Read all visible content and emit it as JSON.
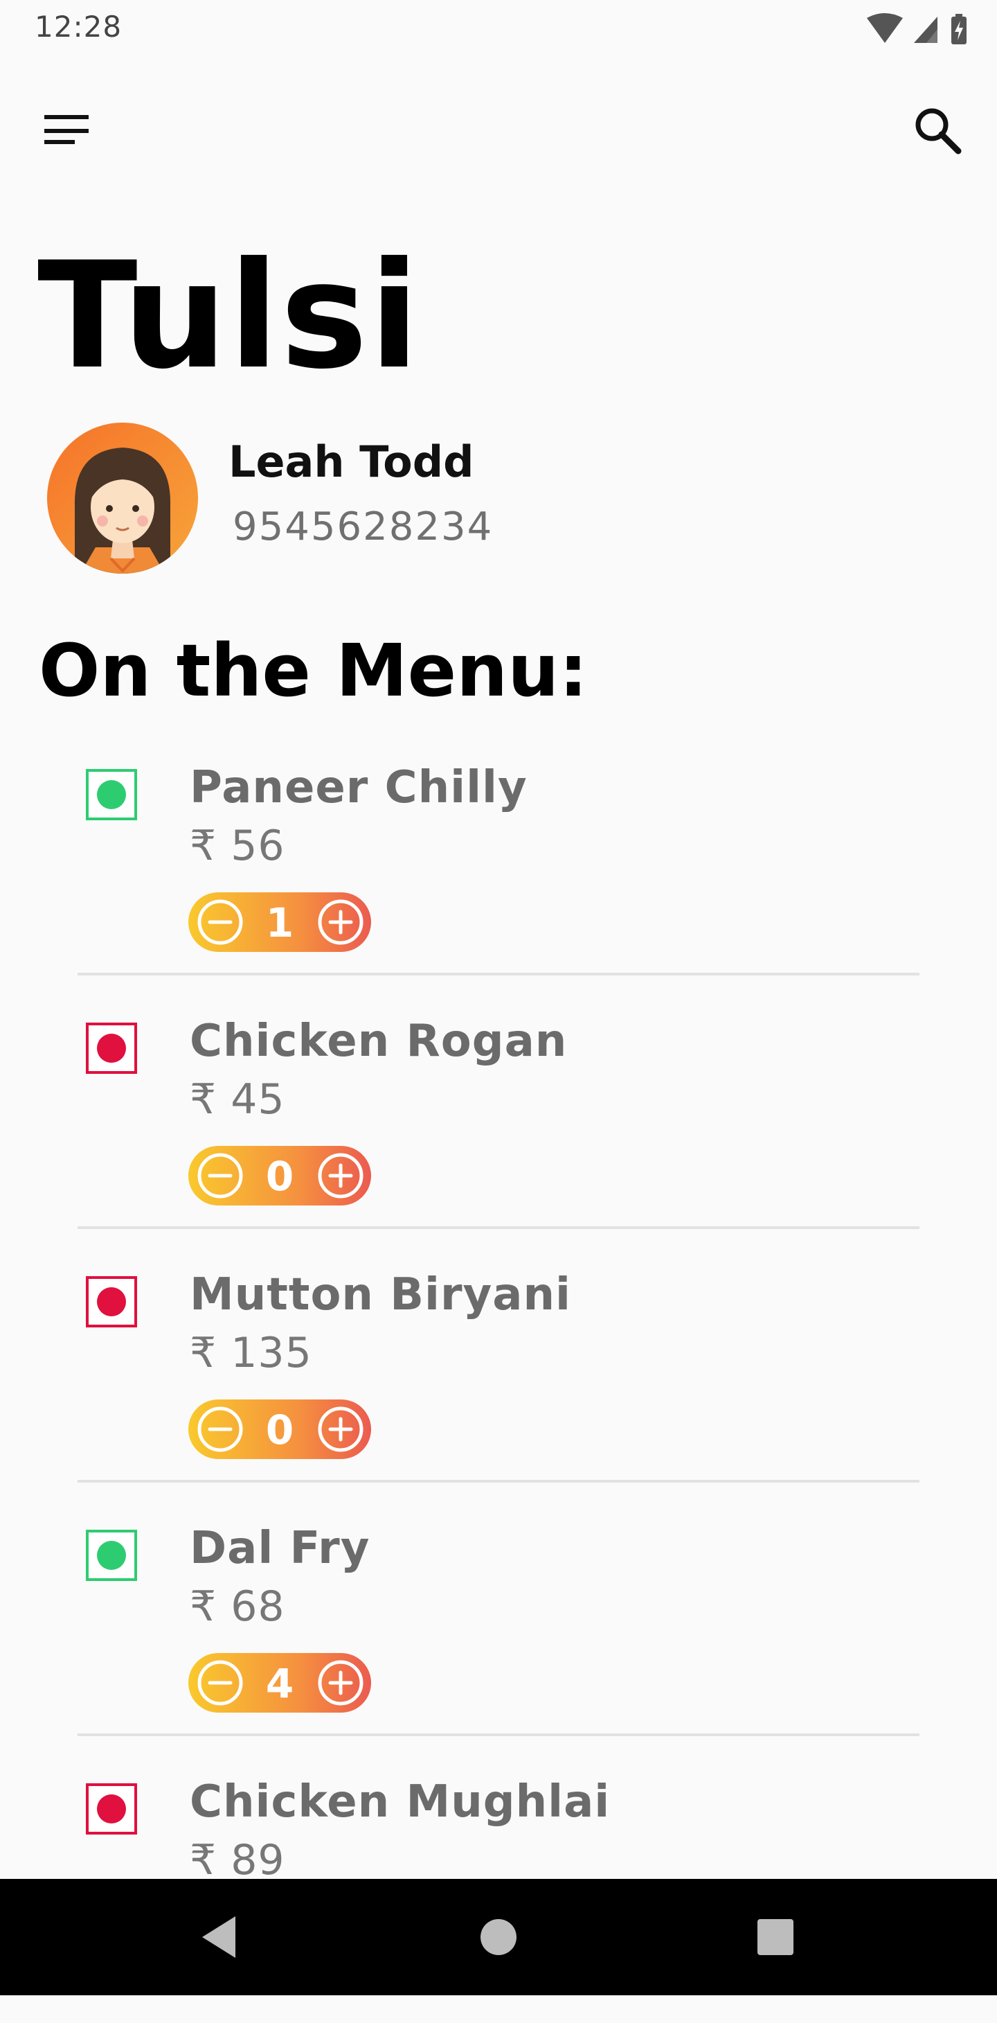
{
  "status_bar": {
    "time": "12:28",
    "icons": [
      "wifi-icon",
      "signal-icon",
      "battery-icon"
    ]
  },
  "toolbar": {
    "menu_icon": "menu-icon",
    "search_icon": "search-icon"
  },
  "restaurant": {
    "title": "Tulsi"
  },
  "user": {
    "name": "Leah Todd",
    "phone": "9545628234"
  },
  "menu": {
    "heading": "On the Menu:",
    "items": [
      {
        "name": "Paneer Chilly",
        "price": "₹ 56",
        "qty": "1",
        "veg": true
      },
      {
        "name": "Chicken Rogan",
        "price": "₹ 45",
        "qty": "0",
        "veg": false
      },
      {
        "name": "Mutton Biryani",
        "price": "₹ 135",
        "qty": "0",
        "veg": false
      },
      {
        "name": "Dal Fry",
        "price": "₹ 68",
        "qty": "4",
        "veg": true
      },
      {
        "name": "Chicken Mughlai",
        "price": "₹ 89",
        "qty": "0",
        "veg": false
      }
    ]
  },
  "colors": {
    "veg": "#2ecc71",
    "nonveg": "#e0103f",
    "stepper_start": "#f9c92d",
    "stepper_end": "#eb5b50"
  },
  "nav_bar": {
    "icons": [
      "back-icon",
      "home-icon",
      "recents-icon"
    ]
  }
}
